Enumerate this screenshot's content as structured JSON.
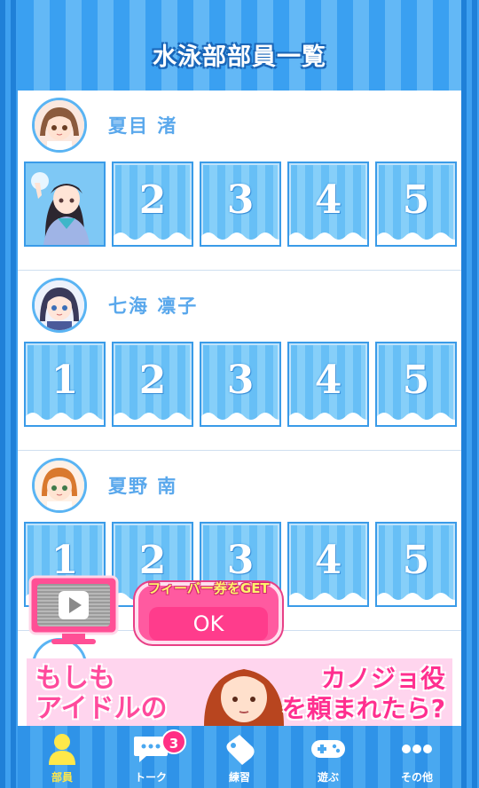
{
  "header": {
    "title": "水泳部部員一覧"
  },
  "members": [
    {
      "name": "夏目 渚",
      "cards": [
        "",
        "2",
        "3",
        "4",
        "5"
      ]
    },
    {
      "name": "七海 凛子",
      "cards": [
        "1",
        "2",
        "3",
        "4",
        "5"
      ]
    },
    {
      "name": "夏野 南",
      "cards": [
        "1",
        "2",
        "3",
        "4",
        "5"
      ]
    }
  ],
  "promo": {
    "cta": "フィーバー券をGET",
    "ok": "OK"
  },
  "ad": {
    "left_line1": "もしも",
    "left_line2": "アイドルの",
    "right_line1": "カノジョ役",
    "right_line2": "を頼まれたら?"
  },
  "nav": {
    "items": [
      {
        "label": "部員",
        "icon": "member-icon",
        "active": true
      },
      {
        "label": "トーク",
        "icon": "talk-icon",
        "badge": "3"
      },
      {
        "label": "練習",
        "icon": "practice-icon"
      },
      {
        "label": "遊ぶ",
        "icon": "game-controller-icon"
      },
      {
        "label": "その他",
        "icon": "more-icon"
      }
    ]
  },
  "colors": {
    "accent": "#3aa0f1",
    "name": "#5aa8ec",
    "promo": "#ff5aa0",
    "badge": "#ff2f84"
  }
}
